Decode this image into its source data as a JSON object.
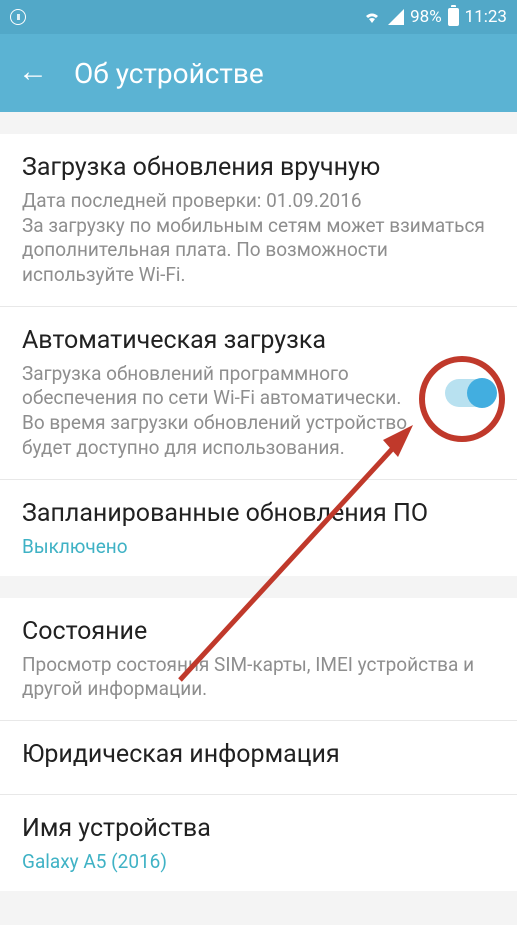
{
  "status": {
    "battery_pct": "98%",
    "time": "11:23"
  },
  "header": {
    "title": "Об устройстве"
  },
  "items": {
    "manual": {
      "title": "Загрузка обновления вручную",
      "sub": "Дата последней проверки: 01.09.2016\nЗа загрузку по мобильным сетям может взиматься дополнительная плата. По возможности используйте Wi-Fi."
    },
    "auto": {
      "title": "Автоматическая загрузка",
      "sub": "Загрузка обновлений программного обеспечения по сети Wi-Fi автоматически. Во время загрузки обновлений устройство будет доступно для использования."
    },
    "scheduled": {
      "title": "Запланированные обновления ПО",
      "link": "Выключено"
    },
    "status_item": {
      "title": "Состояние",
      "sub": "Просмотр состояния SIM-карты, IMEI устройства и другой информации."
    },
    "legal": {
      "title": "Юридическая информация"
    },
    "device_name": {
      "title": "Имя устройства",
      "link": "Galaxy A5 (2016)"
    }
  }
}
